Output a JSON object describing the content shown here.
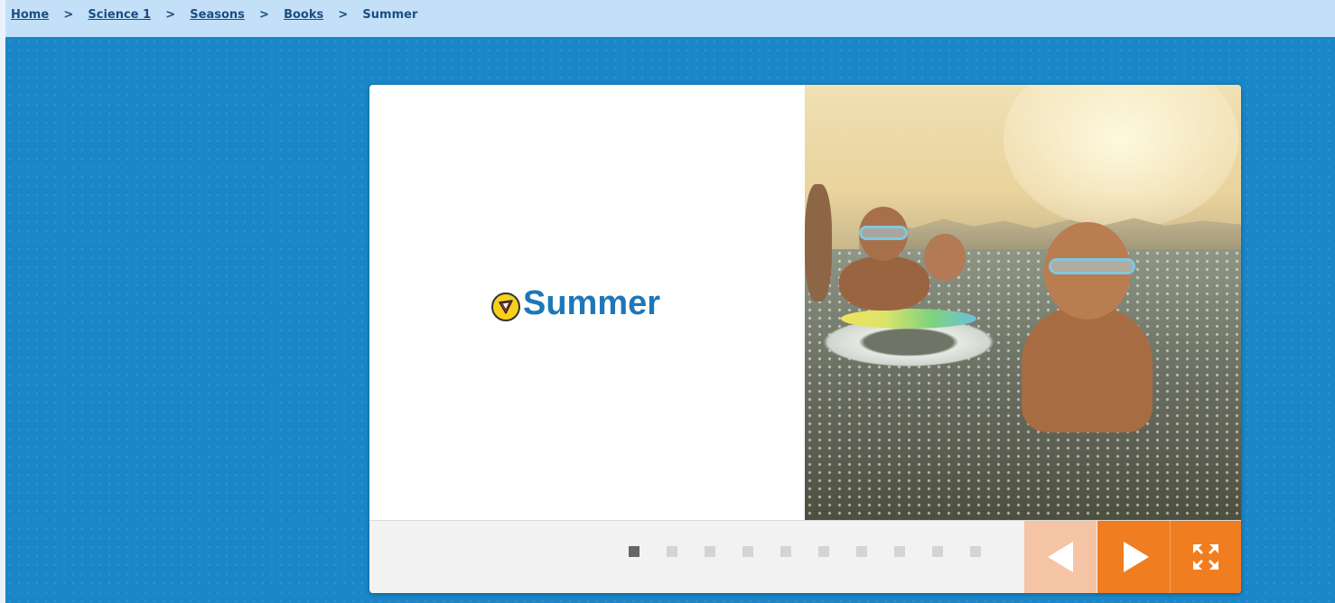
{
  "breadcrumb": {
    "items": [
      "Home",
      "Science 1",
      "Seasons",
      "Books"
    ],
    "separator": ">",
    "current": "Summer"
  },
  "book": {
    "title": "Summer",
    "badge_icon": "dash-badge-icon",
    "photo": "children-splashing-in-sea-photo"
  },
  "pager": {
    "page_count": 10,
    "active_page": 1
  },
  "controls": {
    "prev_icon": "arrow-left-icon",
    "next_icon": "arrow-right-icon",
    "fullscreen_icon": "fullscreen-icon"
  },
  "colors": {
    "background": "#1a86c8",
    "accent": "#f07d20",
    "title": "#1e77b8"
  }
}
